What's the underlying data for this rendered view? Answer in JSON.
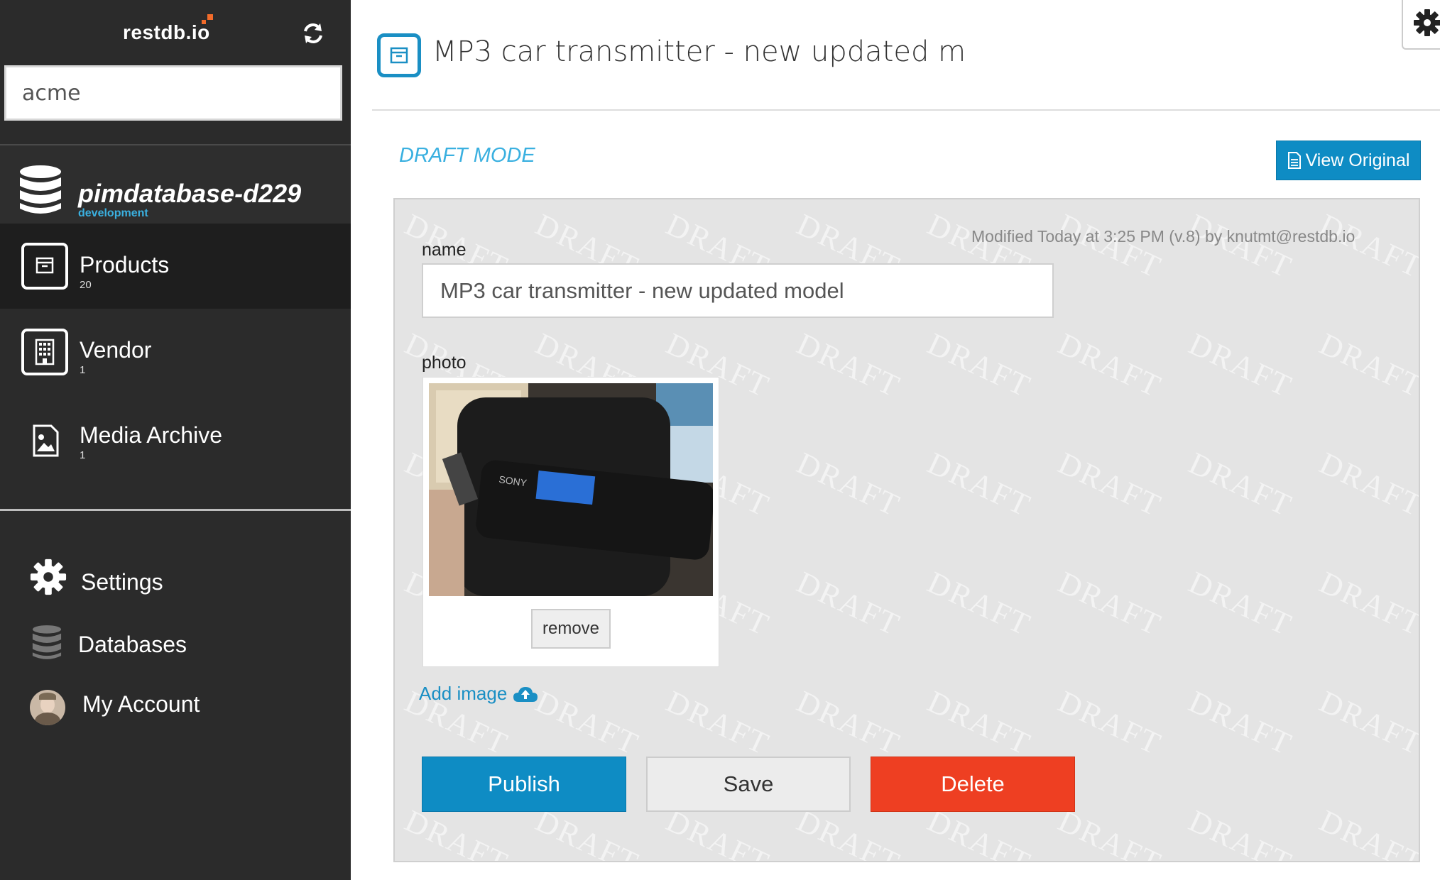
{
  "app": {
    "brand": "restdb.io",
    "brand_accent": "#f26b2a",
    "search_value": "acme"
  },
  "database": {
    "name": "pimdatabase-d229",
    "environment": "development"
  },
  "nav": [
    {
      "label": "Products",
      "count": "20",
      "icon": "archive-icon",
      "active": true
    },
    {
      "label": "Vendor",
      "count": "1",
      "icon": "building-icon",
      "active": false
    },
    {
      "label": "Media Archive",
      "count": "1",
      "icon": "image-file-icon",
      "active": false
    }
  ],
  "bottom_nav": {
    "settings": "Settings",
    "databases": "Databases",
    "account": "My Account"
  },
  "header": {
    "title": "MP3 car transmitter - new updated m"
  },
  "draft": {
    "mode_label": "DRAFT MODE",
    "view_original": "View Original",
    "watermark": "DRAFT",
    "modified": "Modified Today at 3:25 PM (v.8) by knutmt@restdb.io"
  },
  "form": {
    "name_label": "name",
    "name_value": "MP3 car transmitter - new updated model",
    "photo_label": "photo",
    "remove_label": "remove",
    "add_image_label": "Add image"
  },
  "actions": {
    "publish": "Publish",
    "save": "Save",
    "delete": "Delete"
  },
  "colors": {
    "accent_blue": "#0e8cc4",
    "delete_red": "#ee3f22",
    "sidebar_bg": "#2b2b2b"
  }
}
